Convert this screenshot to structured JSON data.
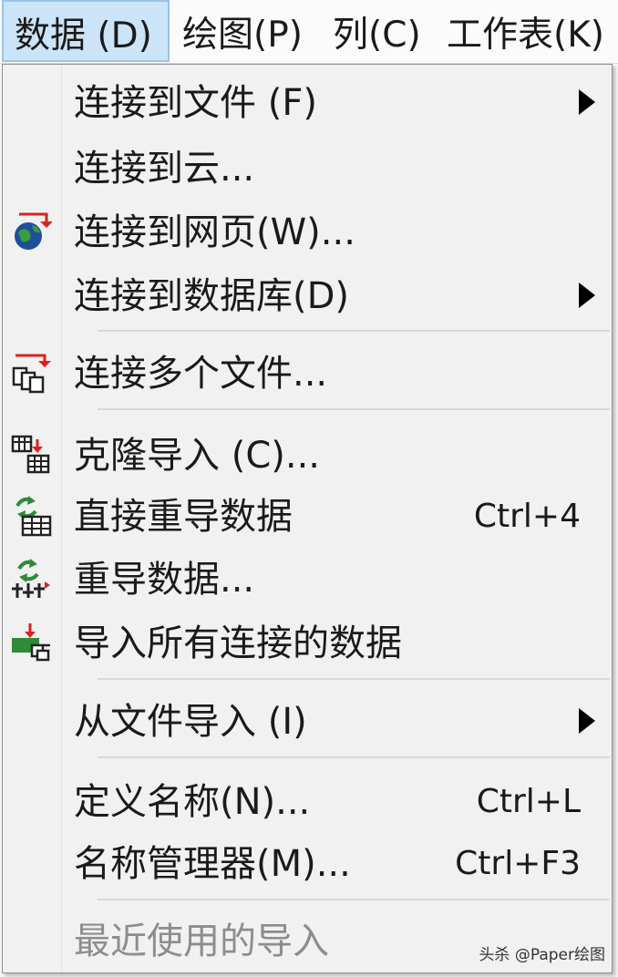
{
  "menubar": {
    "items": [
      {
        "label": "数据 (D)"
      },
      {
        "label": "绘图(P)"
      },
      {
        "label": "列(C)"
      },
      {
        "label": "工作表(K)"
      }
    ]
  },
  "menu": {
    "items": [
      {
        "label": "连接到文件 (F)",
        "icon": "none",
        "submenu": true
      },
      {
        "label": "连接到云...",
        "icon": "none"
      },
      {
        "label": "连接到网页(W)...",
        "icon": "globe-icon"
      },
      {
        "label": "连接到数据库(D)",
        "icon": "none",
        "submenu": true
      },
      {
        "label": "连接多个文件...",
        "icon": "multiple-files-icon"
      },
      {
        "label": "克隆导入 (C)...",
        "icon": "clone-import-icon"
      },
      {
        "label": "直接重导数据",
        "icon": "reimport-direct-icon",
        "shortcut": "Ctrl+4"
      },
      {
        "label": "重导数据...",
        "icon": "reimport-icon"
      },
      {
        "label": "导入所有连接的数据",
        "icon": "import-all-icon"
      },
      {
        "label": "从文件导入 (I)",
        "icon": "none",
        "submenu": true
      },
      {
        "label": "定义名称(N)...",
        "icon": "none",
        "shortcut": "Ctrl+L"
      },
      {
        "label": "名称管理器(M)...",
        "icon": "none",
        "shortcut": "Ctrl+F3"
      },
      {
        "label": "最近使用的导入",
        "icon": "none",
        "disabled": true
      }
    ]
  },
  "watermark": {
    "text": "头杀 @Paper绘图"
  },
  "colors": {
    "active_menu_bg": "#cce4f7",
    "active_menu_border": "#99c4e8",
    "menu_bg": "#f1f1f1",
    "disabled_text": "#8d8d8d",
    "icon_red": "#e02020",
    "icon_green": "#2e8b3a"
  }
}
